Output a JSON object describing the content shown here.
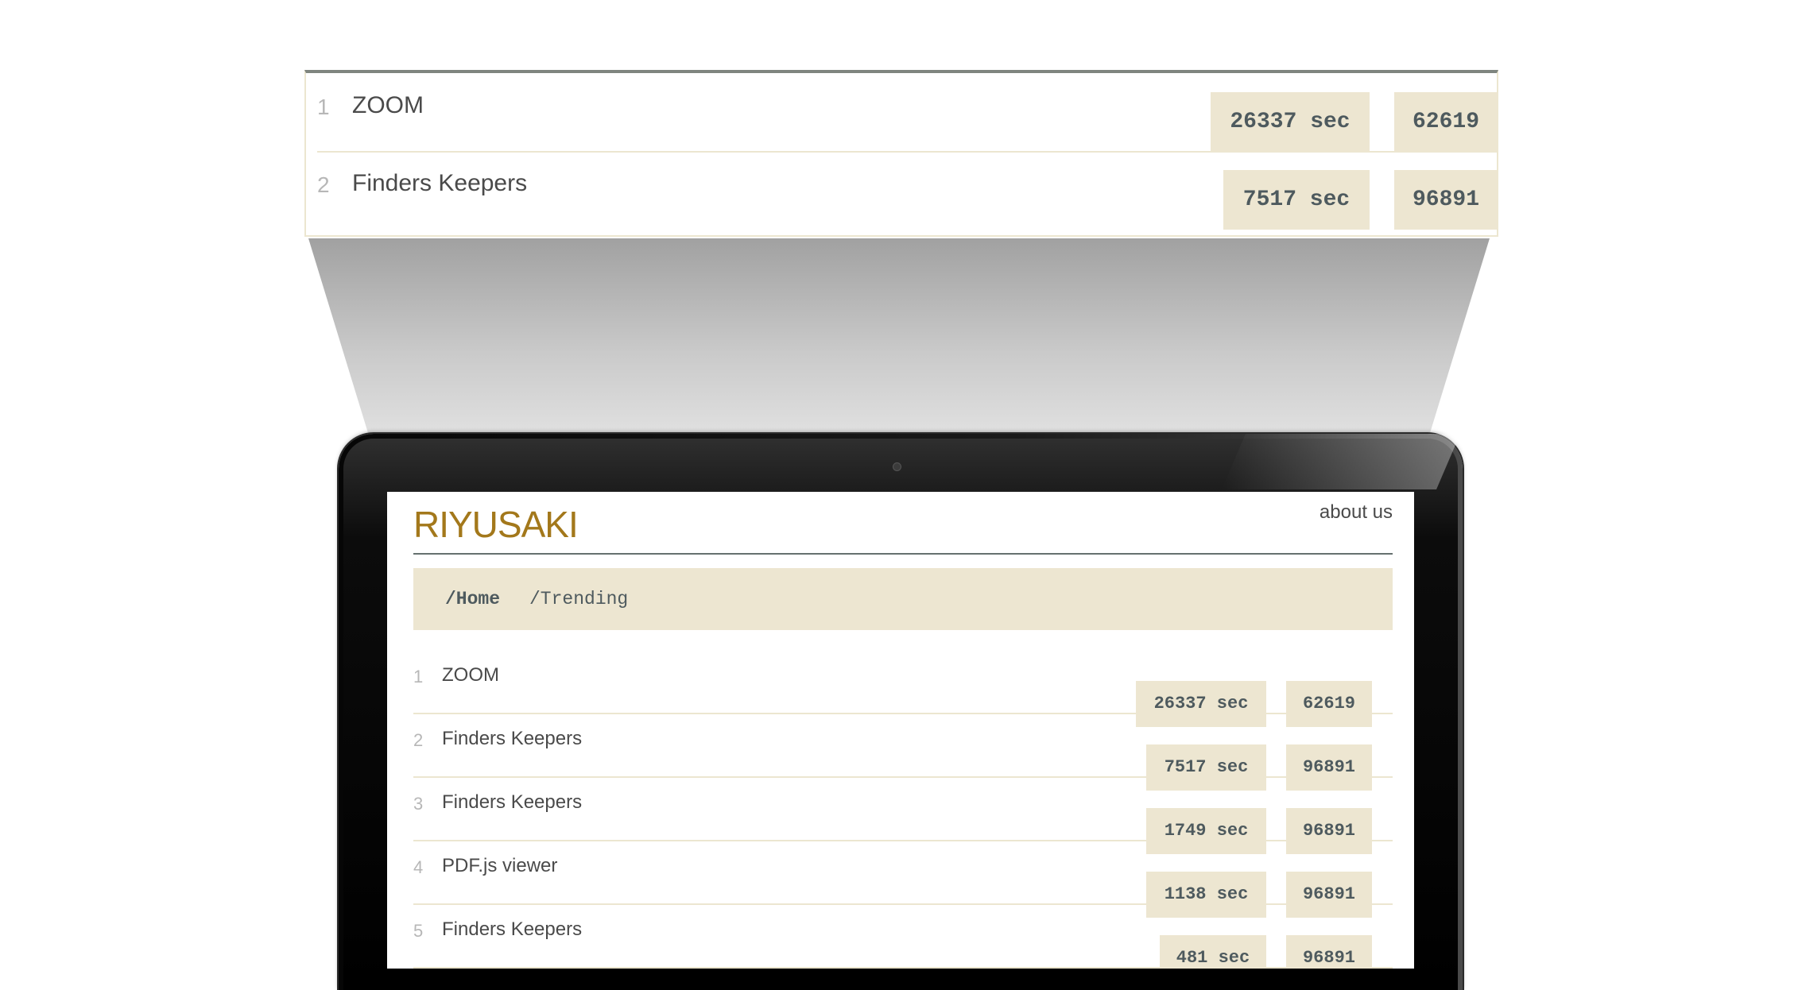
{
  "zoom_panel": {
    "rows": [
      {
        "rank": "1",
        "title": "ZOOM",
        "time": "26337 sec",
        "views": "62619"
      },
      {
        "rank": "2",
        "title": "Finders Keepers",
        "time": "7517 sec",
        "views": "96891"
      }
    ]
  },
  "site": {
    "brand": "RIYUSAKI",
    "nav": {
      "about": "about us"
    },
    "breadcrumb": {
      "home": "/Home",
      "trending": "/Trending"
    },
    "items": [
      {
        "rank": "1",
        "title": "ZOOM",
        "time": "26337 sec",
        "views": "62619"
      },
      {
        "rank": "2",
        "title": "Finders Keepers",
        "time": "7517 sec",
        "views": "96891"
      },
      {
        "rank": "3",
        "title": "Finders Keepers",
        "time": "1749 sec",
        "views": "96891"
      },
      {
        "rank": "4",
        "title": "PDF.js viewer",
        "time": "1138 sec",
        "views": "96891"
      },
      {
        "rank": "5",
        "title": "Finders Keepers",
        "time": "481 sec",
        "views": "96891"
      }
    ]
  },
  "colors": {
    "brand": "#a3781b",
    "badge_bg": "#ede6d1",
    "text": "#4a4a4a",
    "rank": "#b7b7b7"
  }
}
